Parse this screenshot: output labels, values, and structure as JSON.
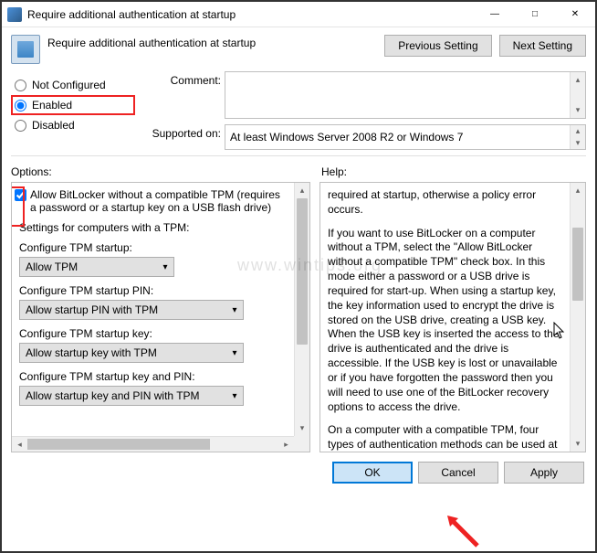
{
  "window": {
    "title": "Require additional authentication at startup"
  },
  "header": {
    "title": "Require additional authentication at startup",
    "prev": "Previous Setting",
    "next": "Next Setting"
  },
  "radios": {
    "not_configured": "Not Configured",
    "enabled": "Enabled",
    "disabled": "Disabled",
    "selected": "enabled"
  },
  "comment": {
    "label": "Comment:",
    "value": ""
  },
  "supported": {
    "label": "Supported on:",
    "value": "At least Windows Server 2008 R2 or Windows 7"
  },
  "panels": {
    "options_label": "Options:",
    "help_label": "Help:"
  },
  "options": {
    "allow_no_tpm_checked": true,
    "allow_no_tpm_label": "Allow BitLocker without a compatible TPM (requires a password or a startup key on a USB flash drive)",
    "tpm_settings_heading": "Settings for computers with a TPM:",
    "tpm_startup_label": "Configure TPM startup:",
    "tpm_startup_value": "Allow TPM",
    "tpm_pin_label": "Configure TPM startup PIN:",
    "tpm_pin_value": "Allow startup PIN with TPM",
    "tpm_key_label": "Configure TPM startup key:",
    "tpm_key_value": "Allow startup key with TPM",
    "tpm_keypin_label": "Configure TPM startup key and PIN:",
    "tpm_keypin_value": "Allow startup key and PIN with TPM"
  },
  "help": {
    "p1": "required at startup, otherwise a policy error occurs.",
    "p2": "If you want to use BitLocker on a computer without a TPM, select the \"Allow BitLocker without a compatible TPM\" check box. In this mode either a password or a USB drive is required for start-up. When using a startup key, the key information used to encrypt the drive is stored on the USB drive, creating a USB key. When the USB key is inserted the access to the drive is authenticated and the drive is accessible. If the USB key is lost or unavailable or if you have forgotten the password then you will need to use one of the BitLocker recovery options to access the drive.",
    "p3": "On a computer with a compatible TPM, four types of authentication methods can be used at startup to provide added protection for encrypted data. When the computer starts, it can use only the TPM for authentication, or it can also require insertion of a USB flash drive containing a startup key, the entry of a 6-digit to 20-digit personal identification number (PIN), or both."
  },
  "buttons": {
    "ok": "OK",
    "cancel": "Cancel",
    "apply": "Apply"
  },
  "watermark": "www.wintips.org"
}
